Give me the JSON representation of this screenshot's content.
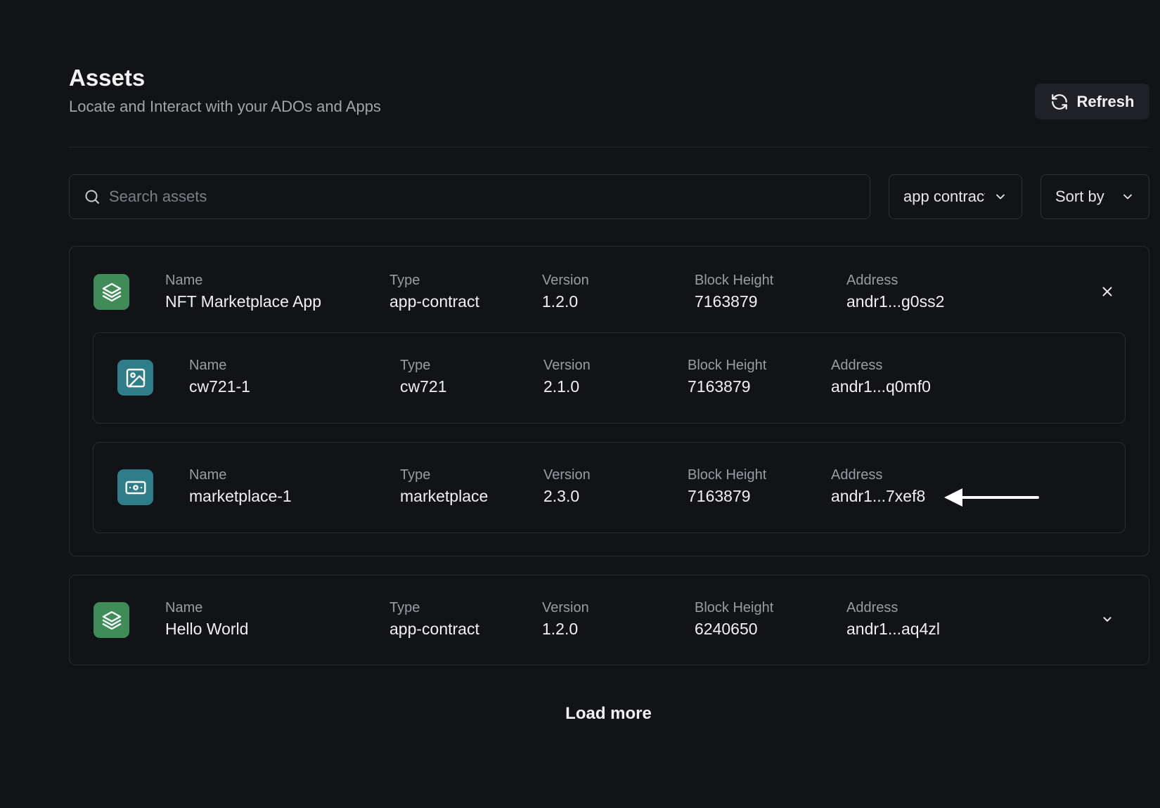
{
  "header": {
    "title": "Assets",
    "subtitle": "Locate and Interact with your ADOs and Apps",
    "refresh_label": "Refresh"
  },
  "search": {
    "placeholder": "Search assets",
    "value": ""
  },
  "filter": {
    "selected": "app contract"
  },
  "sort": {
    "label": "Sort by"
  },
  "labels": {
    "name": "Name",
    "type": "Type",
    "version": "Version",
    "block_height": "Block Height",
    "address": "Address"
  },
  "assets": [
    {
      "name": "NFT Marketplace App",
      "type": "app-contract",
      "version": "1.2.0",
      "block_height": "7163879",
      "address": "andr1...g0ss2",
      "icon": "layers-icon",
      "expanded": true,
      "components": [
        {
          "name": "cw721-1",
          "type": "cw721",
          "version": "2.1.0",
          "block_height": "7163879",
          "address": "andr1...q0mf0",
          "icon": "image-icon"
        },
        {
          "name": "marketplace-1",
          "type": "marketplace",
          "version": "2.3.0",
          "block_height": "7163879",
          "address": "andr1...7xef8",
          "icon": "banknote-icon"
        }
      ]
    },
    {
      "name": "Hello World",
      "type": "app-contract",
      "version": "1.2.0",
      "block_height": "6240650",
      "address": "andr1...aq4zl",
      "icon": "layers-icon",
      "expanded": false
    }
  ],
  "load_more_label": "Load more",
  "colors": {
    "background": "#111317",
    "app_icon": "#3f8c58",
    "component_icon": "#2f7d88"
  }
}
